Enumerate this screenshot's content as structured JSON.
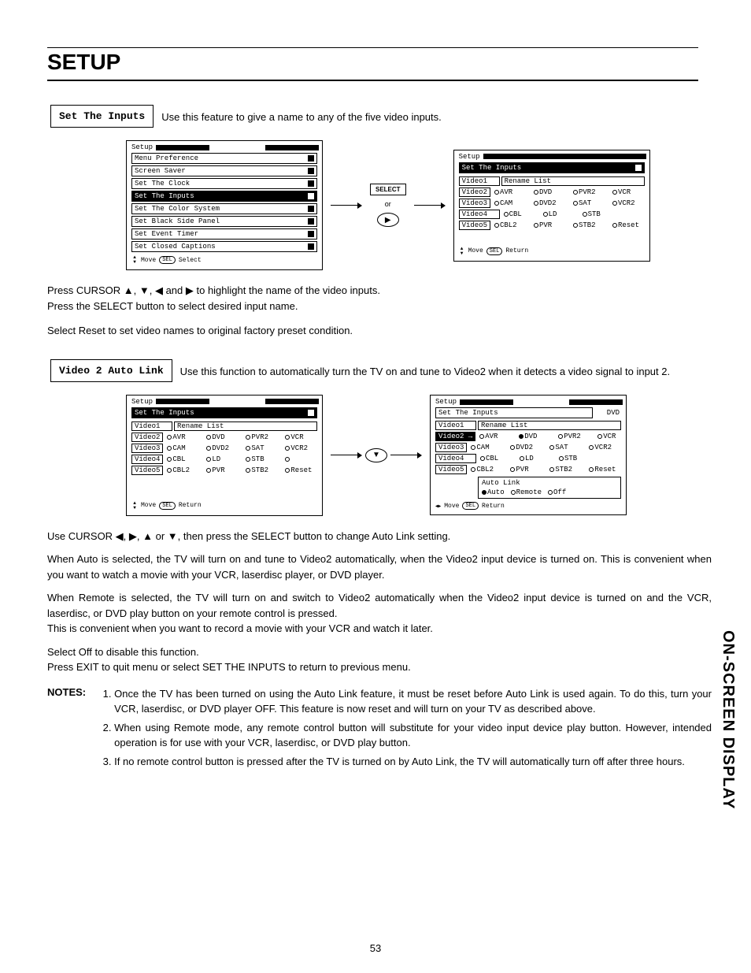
{
  "page_title": "SETUP",
  "side_label": "ON-SCREEN DISPLAY",
  "page_number": "53",
  "section1": {
    "heading": "Set The Inputs",
    "desc": "Use this feature to give a name to any of the five video inputs.",
    "menu_left": {
      "title": "Setup",
      "items": [
        "Menu Preference",
        "Screen Saver",
        "Set The Clock",
        "Set The Inputs",
        "Set The Color System",
        "Set Black Side Panel",
        "Set Event Timer",
        "Set Closed Captions"
      ],
      "highlight_index": 3,
      "footer_move": "Move",
      "footer_sel": "SEL",
      "footer_action": "Select"
    },
    "arrow": {
      "select": "SELECT",
      "or": "or"
    },
    "menu_right": {
      "title": "Setup",
      "subtitle": "Set The Inputs",
      "rows": [
        {
          "label": "Video1",
          "opts_text": "Rename List",
          "single": true
        },
        {
          "label": "Video2",
          "opts": [
            "AVR",
            "DVD",
            "PVR2",
            "VCR"
          ]
        },
        {
          "label": "Video3",
          "opts": [
            "CAM",
            "DVD2",
            "SAT",
            "VCR2"
          ]
        },
        {
          "label": "Video4",
          "opts": [
            "CBL",
            "LD",
            "STB"
          ]
        },
        {
          "label": "Video5",
          "opts": [
            "CBL2",
            "PVR",
            "STB2",
            "Reset"
          ]
        }
      ],
      "footer_move": "Move",
      "footer_sel": "SEL",
      "footer_action": "Return"
    },
    "para1": "Press CURSOR ▲, ▼, ◀ and ▶ to highlight the name of the video inputs.\nPress the SELECT button to select desired input name.",
    "para2": "Select Reset to set video names to original factory preset condition."
  },
  "section2": {
    "heading": "Video 2 Auto Link",
    "desc": "Use this function to automatically turn the TV on and tune to Video2 when it detects a video signal to input 2.",
    "menu_left": {
      "title": "Setup",
      "subtitle": "Set The Inputs",
      "rows": [
        {
          "label": "Video1",
          "opts_text": "Rename List",
          "single": true
        },
        {
          "label": "Video2",
          "opts": [
            "AVR",
            "DVD",
            "PVR2",
            "VCR"
          ]
        },
        {
          "label": "Video3",
          "opts": [
            "CAM",
            "DVD2",
            "SAT",
            "VCR2"
          ]
        },
        {
          "label": "Video4",
          "opts": [
            "CBL",
            "LD",
            "STB",
            ""
          ]
        },
        {
          "label": "Video5",
          "opts": [
            "CBL2",
            "PVR",
            "STB2",
            "Reset"
          ]
        }
      ],
      "footer_move": "Move",
      "footer_sel": "SEL",
      "footer_action": "Return"
    },
    "menu_right": {
      "title": "Setup",
      "subtitle": "Set The Inputs",
      "right_label": "DVD",
      "rows": [
        {
          "label": "Video1",
          "opts_text": "Rename List",
          "single": true
        },
        {
          "label": "Video2",
          "opts": [
            "AVR",
            "DVD",
            "PVR2",
            "VCR"
          ],
          "sel": 1,
          "hl": true,
          "arrow": true
        },
        {
          "label": "Video3",
          "opts": [
            "CAM",
            "DVD2",
            "SAT",
            "VCR2"
          ]
        },
        {
          "label": "Video4",
          "opts": [
            "CBL",
            "LD",
            "STB"
          ]
        },
        {
          "label": "Video5",
          "opts": [
            "CBL2",
            "PVR",
            "STB2",
            "Reset"
          ]
        }
      ],
      "auto_link": {
        "title": "Auto Link",
        "opts": [
          "Auto",
          "Remote",
          "Off"
        ],
        "sel": 0
      },
      "footer_move": "Move",
      "footer_sel": "SEL",
      "footer_action": "Return",
      "footer_lr": true
    },
    "para1": "Use CURSOR ◀, ▶, ▲ or ▼, then press the SELECT button to change Auto Link setting.",
    "para2": "When Auto is selected, the TV will turn on and tune to Video2 automatically, when the Video2 input device is turned on. This is convenient when you want to watch a movie with your VCR, laserdisc player, or DVD player.",
    "para3": "When Remote is selected, the TV will turn on and switch to Video2 automatically when the Video2 input device is turned on and the VCR, laserdisc, or DVD play button on your remote control is pressed.\nThis is convenient when you want to record a movie with your VCR and watch it later.",
    "para4": "Select Off to disable this function.\nPress EXIT to quit menu or select SET THE INPUTS to return to previous menu."
  },
  "notes": {
    "label": "NOTES:",
    "items": [
      "Once the TV has been turned on using the Auto Link feature, it must be reset before Auto Link is used again. To do this, turn your VCR, laserdisc, or DVD player OFF. This feature is now reset and will turn on your TV as described above.",
      "When using Remote mode, any remote control button will substitute for your video input device play button. However, intended operation is for use with your VCR, laserdisc, or DVD play button.",
      "If no remote control button is pressed after the TV is turned on by Auto Link, the TV will automatically turn off after three hours."
    ]
  }
}
